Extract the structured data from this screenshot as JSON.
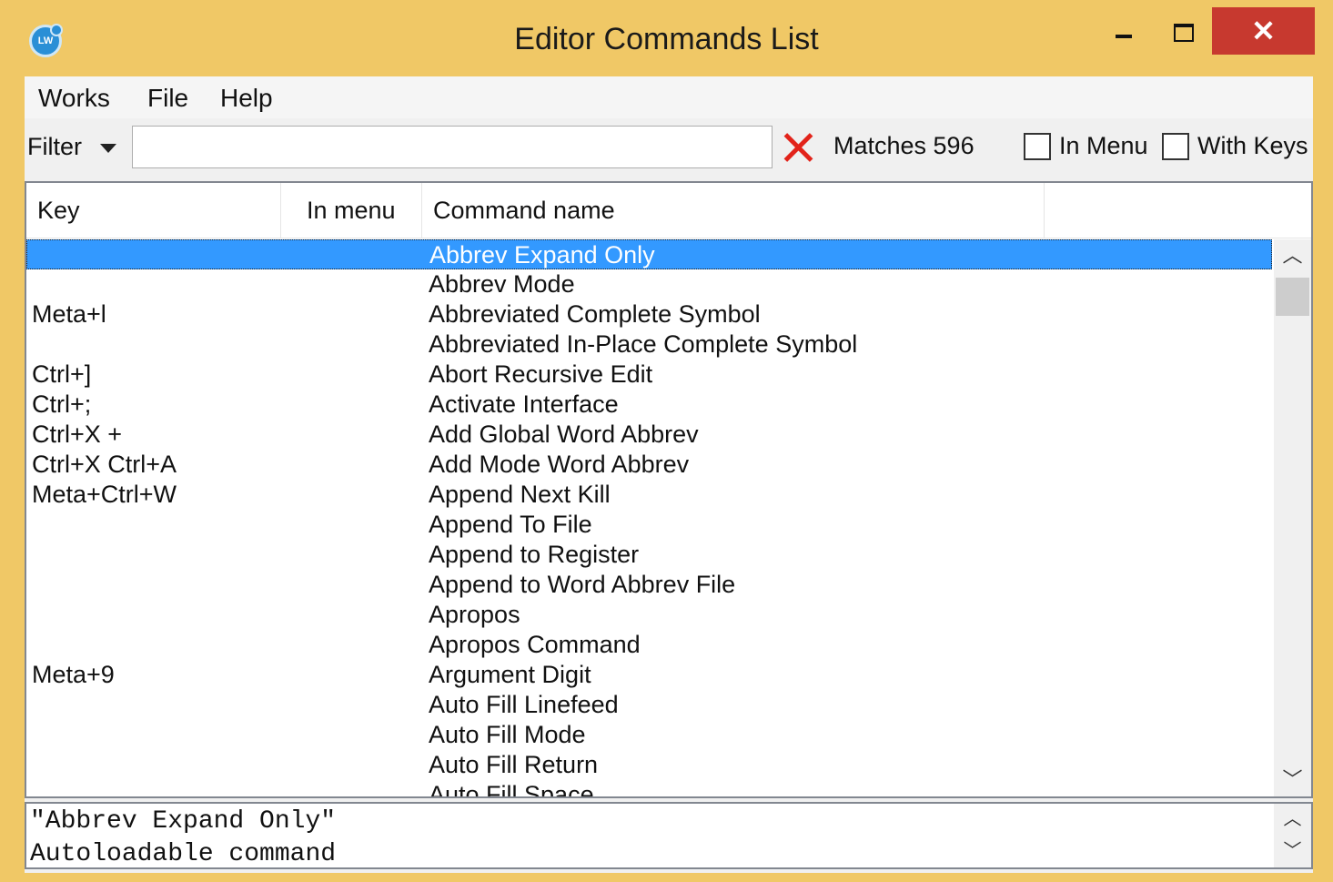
{
  "window": {
    "title": "Editor Commands List",
    "app_icon": "lw-logo-icon",
    "controls": {
      "minimize_icon": "minimize-icon",
      "maximize_icon": "maximize-icon",
      "close_glyph": "✕"
    }
  },
  "menubar": {
    "items": [
      {
        "label": "Works"
      },
      {
        "label": "File"
      },
      {
        "label": "Help"
      }
    ]
  },
  "filterbar": {
    "filter_label": "Filter",
    "filter_value": "",
    "matches_text": "Matches 596",
    "in_menu_label": "In Menu",
    "in_menu_checked": false,
    "with_keys_label": "With Keys",
    "with_keys_checked": false
  },
  "table": {
    "columns": [
      "Key",
      "In menu",
      "Command name"
    ],
    "selected_index": 0,
    "rows": [
      {
        "key": "",
        "in_menu": "",
        "command": "Abbrev Expand Only"
      },
      {
        "key": "",
        "in_menu": "",
        "command": "Abbrev Mode"
      },
      {
        "key": "Meta+l",
        "in_menu": "",
        "command": "Abbreviated Complete Symbol"
      },
      {
        "key": "",
        "in_menu": "",
        "command": "Abbreviated In-Place Complete Symbol"
      },
      {
        "key": "Ctrl+]",
        "in_menu": "",
        "command": "Abort Recursive Edit"
      },
      {
        "key": "Ctrl+;",
        "in_menu": "",
        "command": "Activate Interface"
      },
      {
        "key": "Ctrl+X +",
        "in_menu": "",
        "command": "Add Global Word Abbrev"
      },
      {
        "key": "Ctrl+X Ctrl+A",
        "in_menu": "",
        "command": "Add Mode Word Abbrev"
      },
      {
        "key": "Meta+Ctrl+W",
        "in_menu": "",
        "command": "Append Next Kill"
      },
      {
        "key": "",
        "in_menu": "",
        "command": "Append To File"
      },
      {
        "key": "",
        "in_menu": "",
        "command": "Append to Register"
      },
      {
        "key": "",
        "in_menu": "",
        "command": "Append to Word Abbrev File"
      },
      {
        "key": "",
        "in_menu": "",
        "command": "Apropos"
      },
      {
        "key": "",
        "in_menu": "",
        "command": "Apropos Command"
      },
      {
        "key": "Meta+9",
        "in_menu": "",
        "command": "Argument Digit"
      },
      {
        "key": "",
        "in_menu": "",
        "command": "Auto Fill Linefeed"
      },
      {
        "key": "",
        "in_menu": "",
        "command": "Auto Fill Mode"
      },
      {
        "key": "",
        "in_menu": "",
        "command": "Auto Fill Return"
      },
      {
        "key": "",
        "in_menu": "",
        "command": "Auto Fill Space"
      }
    ]
  },
  "description": {
    "lines": [
      "\"Abbrev Expand Only\"",
      "Autoloadable command"
    ]
  },
  "colors": {
    "frame": "#f0c866",
    "selection": "#3399ff",
    "close_button": "#c7392f",
    "clear_icon": "#e2231a"
  }
}
